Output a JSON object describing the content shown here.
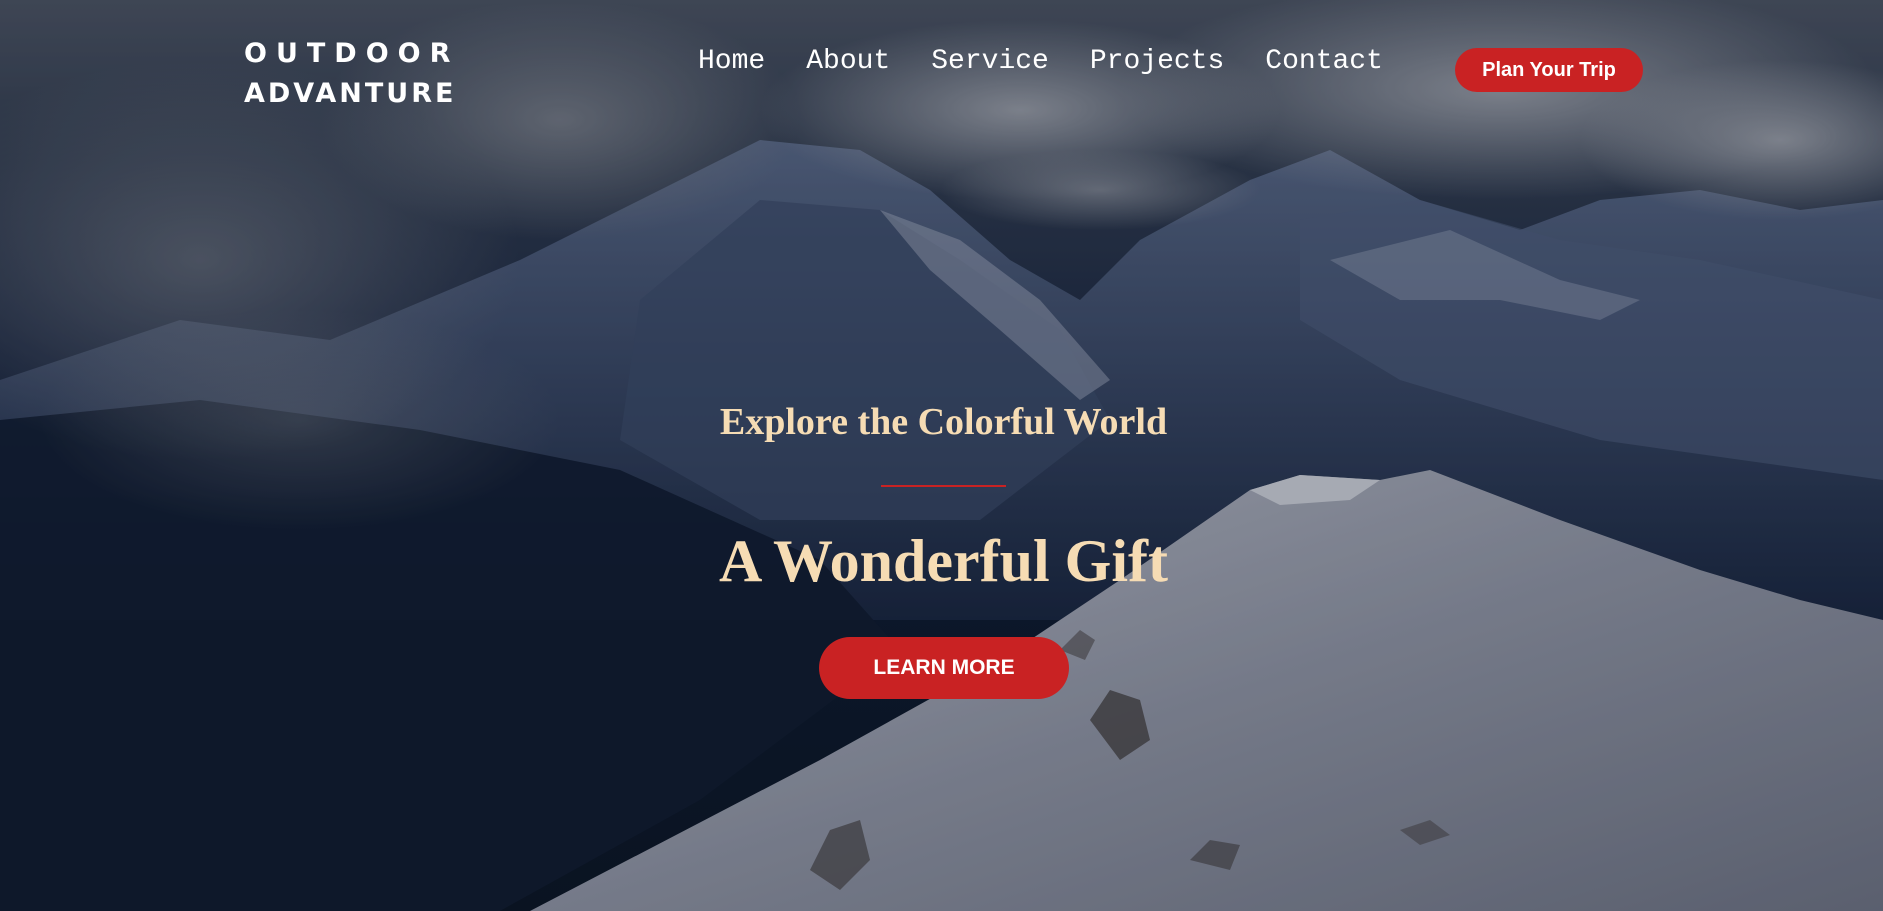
{
  "brand": {
    "line1": "OUTDOOR",
    "line2": "ADVANTURE"
  },
  "nav": {
    "items": [
      {
        "label": "Home"
      },
      {
        "label": "About"
      },
      {
        "label": "Service"
      },
      {
        "label": "Projects"
      },
      {
        "label": "Contact"
      }
    ],
    "cta_label": "Plan Your Trip"
  },
  "hero": {
    "subtitle": "Explore the Colorful World",
    "headline": "A Wonderful Gift",
    "button_label": "LEARN MORE",
    "background": "snowy-mountain-photo"
  },
  "colors": {
    "accent": "#c92223",
    "heading": "#f6dcb4",
    "nav_text": "#ffffff"
  }
}
